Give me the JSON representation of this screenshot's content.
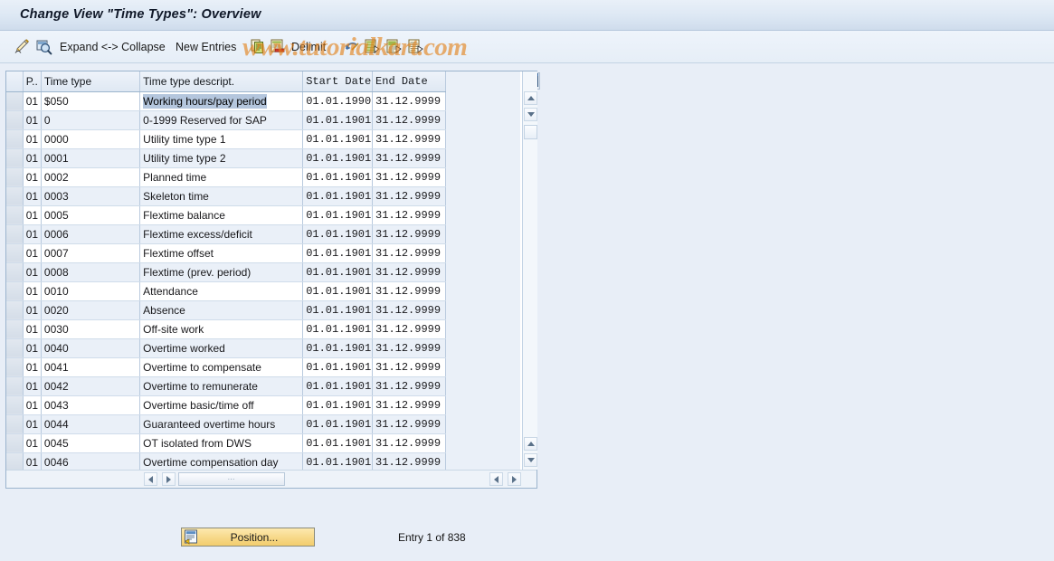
{
  "window": {
    "title": "Change View \"Time Types\": Overview"
  },
  "toolbar": {
    "items": [
      {
        "name": "display-change-icon",
        "icon": "pencil-icon",
        "label": ""
      },
      {
        "name": "select-layout-icon",
        "icon": "magnifier-icon",
        "label": ""
      },
      {
        "name": "expand-collapse-button",
        "icon": "",
        "label": "Expand <-> Collapse"
      },
      {
        "name": "new-entries-button",
        "icon": "",
        "label": "New Entries"
      },
      {
        "name": "copy-as-icon",
        "icon": "copy-icon",
        "label": ""
      },
      {
        "name": "delete-icon",
        "icon": "delete-row-icon",
        "label": ""
      },
      {
        "name": "delimit-button",
        "icon": "",
        "label": "Delimit"
      },
      {
        "name": "undo-icon",
        "icon": "undo-icon",
        "label": ""
      },
      {
        "name": "select-all-icon",
        "icon": "select-all-icon",
        "label": ""
      },
      {
        "name": "deselect-all-icon",
        "icon": "deselect-all-icon",
        "label": ""
      },
      {
        "name": "select-block-icon",
        "icon": "select-block-icon",
        "label": ""
      }
    ]
  },
  "table": {
    "columns": [
      {
        "key": "sel",
        "label": ""
      },
      {
        "key": "p",
        "label": "P.."
      },
      {
        "key": "timetype",
        "label": "Time type"
      },
      {
        "key": "descript",
        "label": "Time type descript."
      },
      {
        "key": "start",
        "label": "Start Date"
      },
      {
        "key": "end",
        "label": "End Date"
      }
    ],
    "rows": [
      {
        "p": "01",
        "timetype": "$050",
        "descript": "Working hours/pay period",
        "start": "01.01.1990",
        "end": "31.12.9999",
        "selected": true
      },
      {
        "p": "01",
        "timetype": "0",
        "descript": "0-1999 Reserved for SAP",
        "start": "01.01.1901",
        "end": "31.12.9999"
      },
      {
        "p": "01",
        "timetype": "0000",
        "descript": "Utility time type 1",
        "start": "01.01.1901",
        "end": "31.12.9999"
      },
      {
        "p": "01",
        "timetype": "0001",
        "descript": "Utility time type 2",
        "start": "01.01.1901",
        "end": "31.12.9999"
      },
      {
        "p": "01",
        "timetype": "0002",
        "descript": "Planned time",
        "start": "01.01.1901",
        "end": "31.12.9999"
      },
      {
        "p": "01",
        "timetype": "0003",
        "descript": "Skeleton time",
        "start": "01.01.1901",
        "end": "31.12.9999"
      },
      {
        "p": "01",
        "timetype": "0005",
        "descript": "Flextime balance",
        "start": "01.01.1901",
        "end": "31.12.9999"
      },
      {
        "p": "01",
        "timetype": "0006",
        "descript": "Flextime excess/deficit",
        "start": "01.01.1901",
        "end": "31.12.9999"
      },
      {
        "p": "01",
        "timetype": "0007",
        "descript": "Flextime offset",
        "start": "01.01.1901",
        "end": "31.12.9999"
      },
      {
        "p": "01",
        "timetype": "0008",
        "descript": "Flextime (prev. period)",
        "start": "01.01.1901",
        "end": "31.12.9999"
      },
      {
        "p": "01",
        "timetype": "0010",
        "descript": "Attendance",
        "start": "01.01.1901",
        "end": "31.12.9999"
      },
      {
        "p": "01",
        "timetype": "0020",
        "descript": "Absence",
        "start": "01.01.1901",
        "end": "31.12.9999"
      },
      {
        "p": "01",
        "timetype": "0030",
        "descript": "Off-site work",
        "start": "01.01.1901",
        "end": "31.12.9999"
      },
      {
        "p": "01",
        "timetype": "0040",
        "descript": "Overtime worked",
        "start": "01.01.1901",
        "end": "31.12.9999"
      },
      {
        "p": "01",
        "timetype": "0041",
        "descript": "Overtime to compensate",
        "start": "01.01.1901",
        "end": "31.12.9999"
      },
      {
        "p": "01",
        "timetype": "0042",
        "descript": "Overtime to remunerate",
        "start": "01.01.1901",
        "end": "31.12.9999"
      },
      {
        "p": "01",
        "timetype": "0043",
        "descript": "Overtime basic/time off",
        "start": "01.01.1901",
        "end": "31.12.9999"
      },
      {
        "p": "01",
        "timetype": "0044",
        "descript": "Guaranteed overtime hours",
        "start": "01.01.1901",
        "end": "31.12.9999"
      },
      {
        "p": "01",
        "timetype": "0045",
        "descript": "OT isolated from DWS",
        "start": "01.01.1901",
        "end": "31.12.9999"
      },
      {
        "p": "01",
        "timetype": "0046",
        "descript": "Overtime compensation day",
        "start": "01.01.1901",
        "end": "31.12.9999"
      }
    ]
  },
  "footer": {
    "position_button_label": "Position...",
    "entry_status": "Entry 1 of 838"
  },
  "watermark": {
    "text": "www.tutorialkart.com"
  },
  "colors": {
    "background": "#e8eef7",
    "title_gradient_top": "#e9f0f8",
    "grid_alt_row": "#eaf0f8",
    "selection_highlight": "#b4c6dd",
    "button_yellow": "#f7d888",
    "watermark": "#e27f17"
  }
}
